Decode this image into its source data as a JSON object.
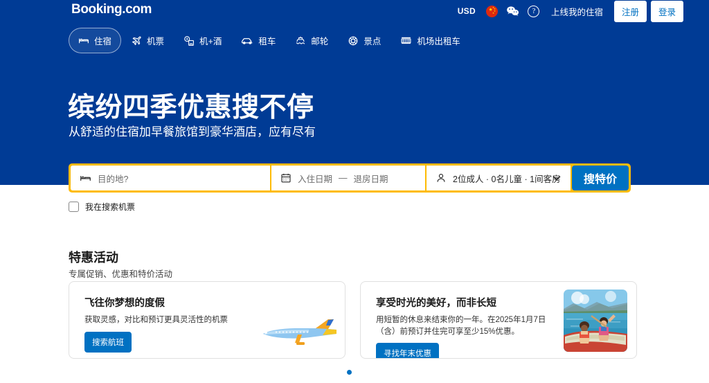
{
  "brand": {
    "logo_text": "Booking.com",
    "primary_blue": "#003b95",
    "accent_blue": "#0071c2",
    "accent_yellow": "#febb02"
  },
  "topbar": {
    "currency": "USD",
    "flag_icon": "china-flag-icon",
    "wechat_icon": "wechat-icon",
    "help_icon": "help-circle-icon",
    "list_property": "上线我的住宿",
    "register": "注册",
    "login": "登录"
  },
  "nav": {
    "items": [
      {
        "label": "住宿",
        "icon": "bed-icon",
        "active": true
      },
      {
        "label": "机票",
        "icon": "airplane-icon",
        "active": false
      },
      {
        "label": "机+酒",
        "icon": "flight-hotel-icon",
        "active": false
      },
      {
        "label": "租车",
        "icon": "car-icon",
        "active": false
      },
      {
        "label": "邮轮",
        "icon": "cruise-ship-icon",
        "active": false
      },
      {
        "label": "景点",
        "icon": "attractions-icon",
        "active": false
      },
      {
        "label": "机场出租车",
        "icon": "airport-taxi-icon",
        "active": false
      }
    ]
  },
  "hero": {
    "title": "缤纷四季优惠搜不停",
    "subtitle": "从舒适的住宿加早餐旅馆到豪华酒店，应有尽有"
  },
  "search": {
    "destination_placeholder": "目的地?",
    "destination_icon": "bed-icon",
    "checkin_label": "入住日期",
    "date_separator": "—",
    "checkout_label": "退房日期",
    "calendar_icon": "calendar-icon",
    "occupancy_value": "2位成人 · 0名儿童 · 1间客房",
    "person_icon": "person-icon",
    "chevron_icon": "chevron-down-icon",
    "submit_label": "搜特价",
    "flight_checkbox_label": "我在搜索机票",
    "flight_checkbox_checked": false
  },
  "deals": {
    "heading": "特惠活动",
    "subheading": "专属促销、优惠和特价活动",
    "cards": [
      {
        "title": "飞往你梦想的度假",
        "body": "获取灵感，对比和预订更具灵活性的机票",
        "cta": "搜索航班",
        "art": "airplane-illustration"
      },
      {
        "title": "享受时光的美好，而非长短",
        "body": "用短暂的休息来结束你的一年。在2025年1月7日（含）前预订并住完可享至少15%优惠。",
        "cta": "寻找年末优惠",
        "art": "canoe-photo"
      }
    ],
    "carousel_dot_active_index": 0
  }
}
